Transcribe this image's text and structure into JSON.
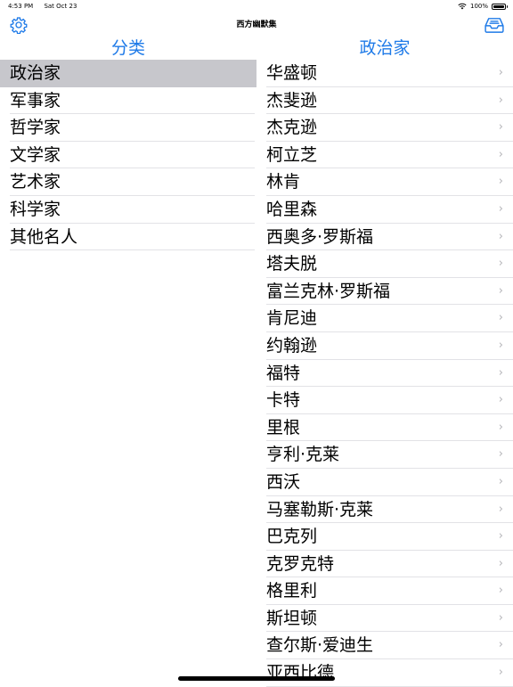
{
  "status_bar": {
    "time": "4:53 PM",
    "date": "Sat Oct 23",
    "battery": "100%"
  },
  "nav": {
    "title": "西方幽默集",
    "left_icon": "gear-icon",
    "right_icon": "tray-icon"
  },
  "categories": {
    "header": "分类",
    "items": [
      "政治家",
      "军事家",
      "哲学家",
      "文学家",
      "艺术家",
      "科学家",
      "其他名人"
    ],
    "selected": "政治家"
  },
  "people": {
    "header": "政治家",
    "items": [
      "华盛顿",
      "杰斐逊",
      "杰克逊",
      "柯立芝",
      "林肯",
      "哈里森",
      "西奥多·罗斯福",
      "塔夫脱",
      "富兰克林·罗斯福",
      "肯尼迪",
      "约翰逊",
      "福特",
      "卡特",
      "里根",
      "亨利·克莱",
      "西沃",
      "马塞勒斯·克莱",
      "巴克列",
      "克罗克特",
      "格里利",
      "斯坦顿",
      "查尔斯·爱迪生",
      "亚西比德"
    ]
  },
  "colors": {
    "accent": "#1e7ae8",
    "selected_row": "#c7c7cc"
  }
}
